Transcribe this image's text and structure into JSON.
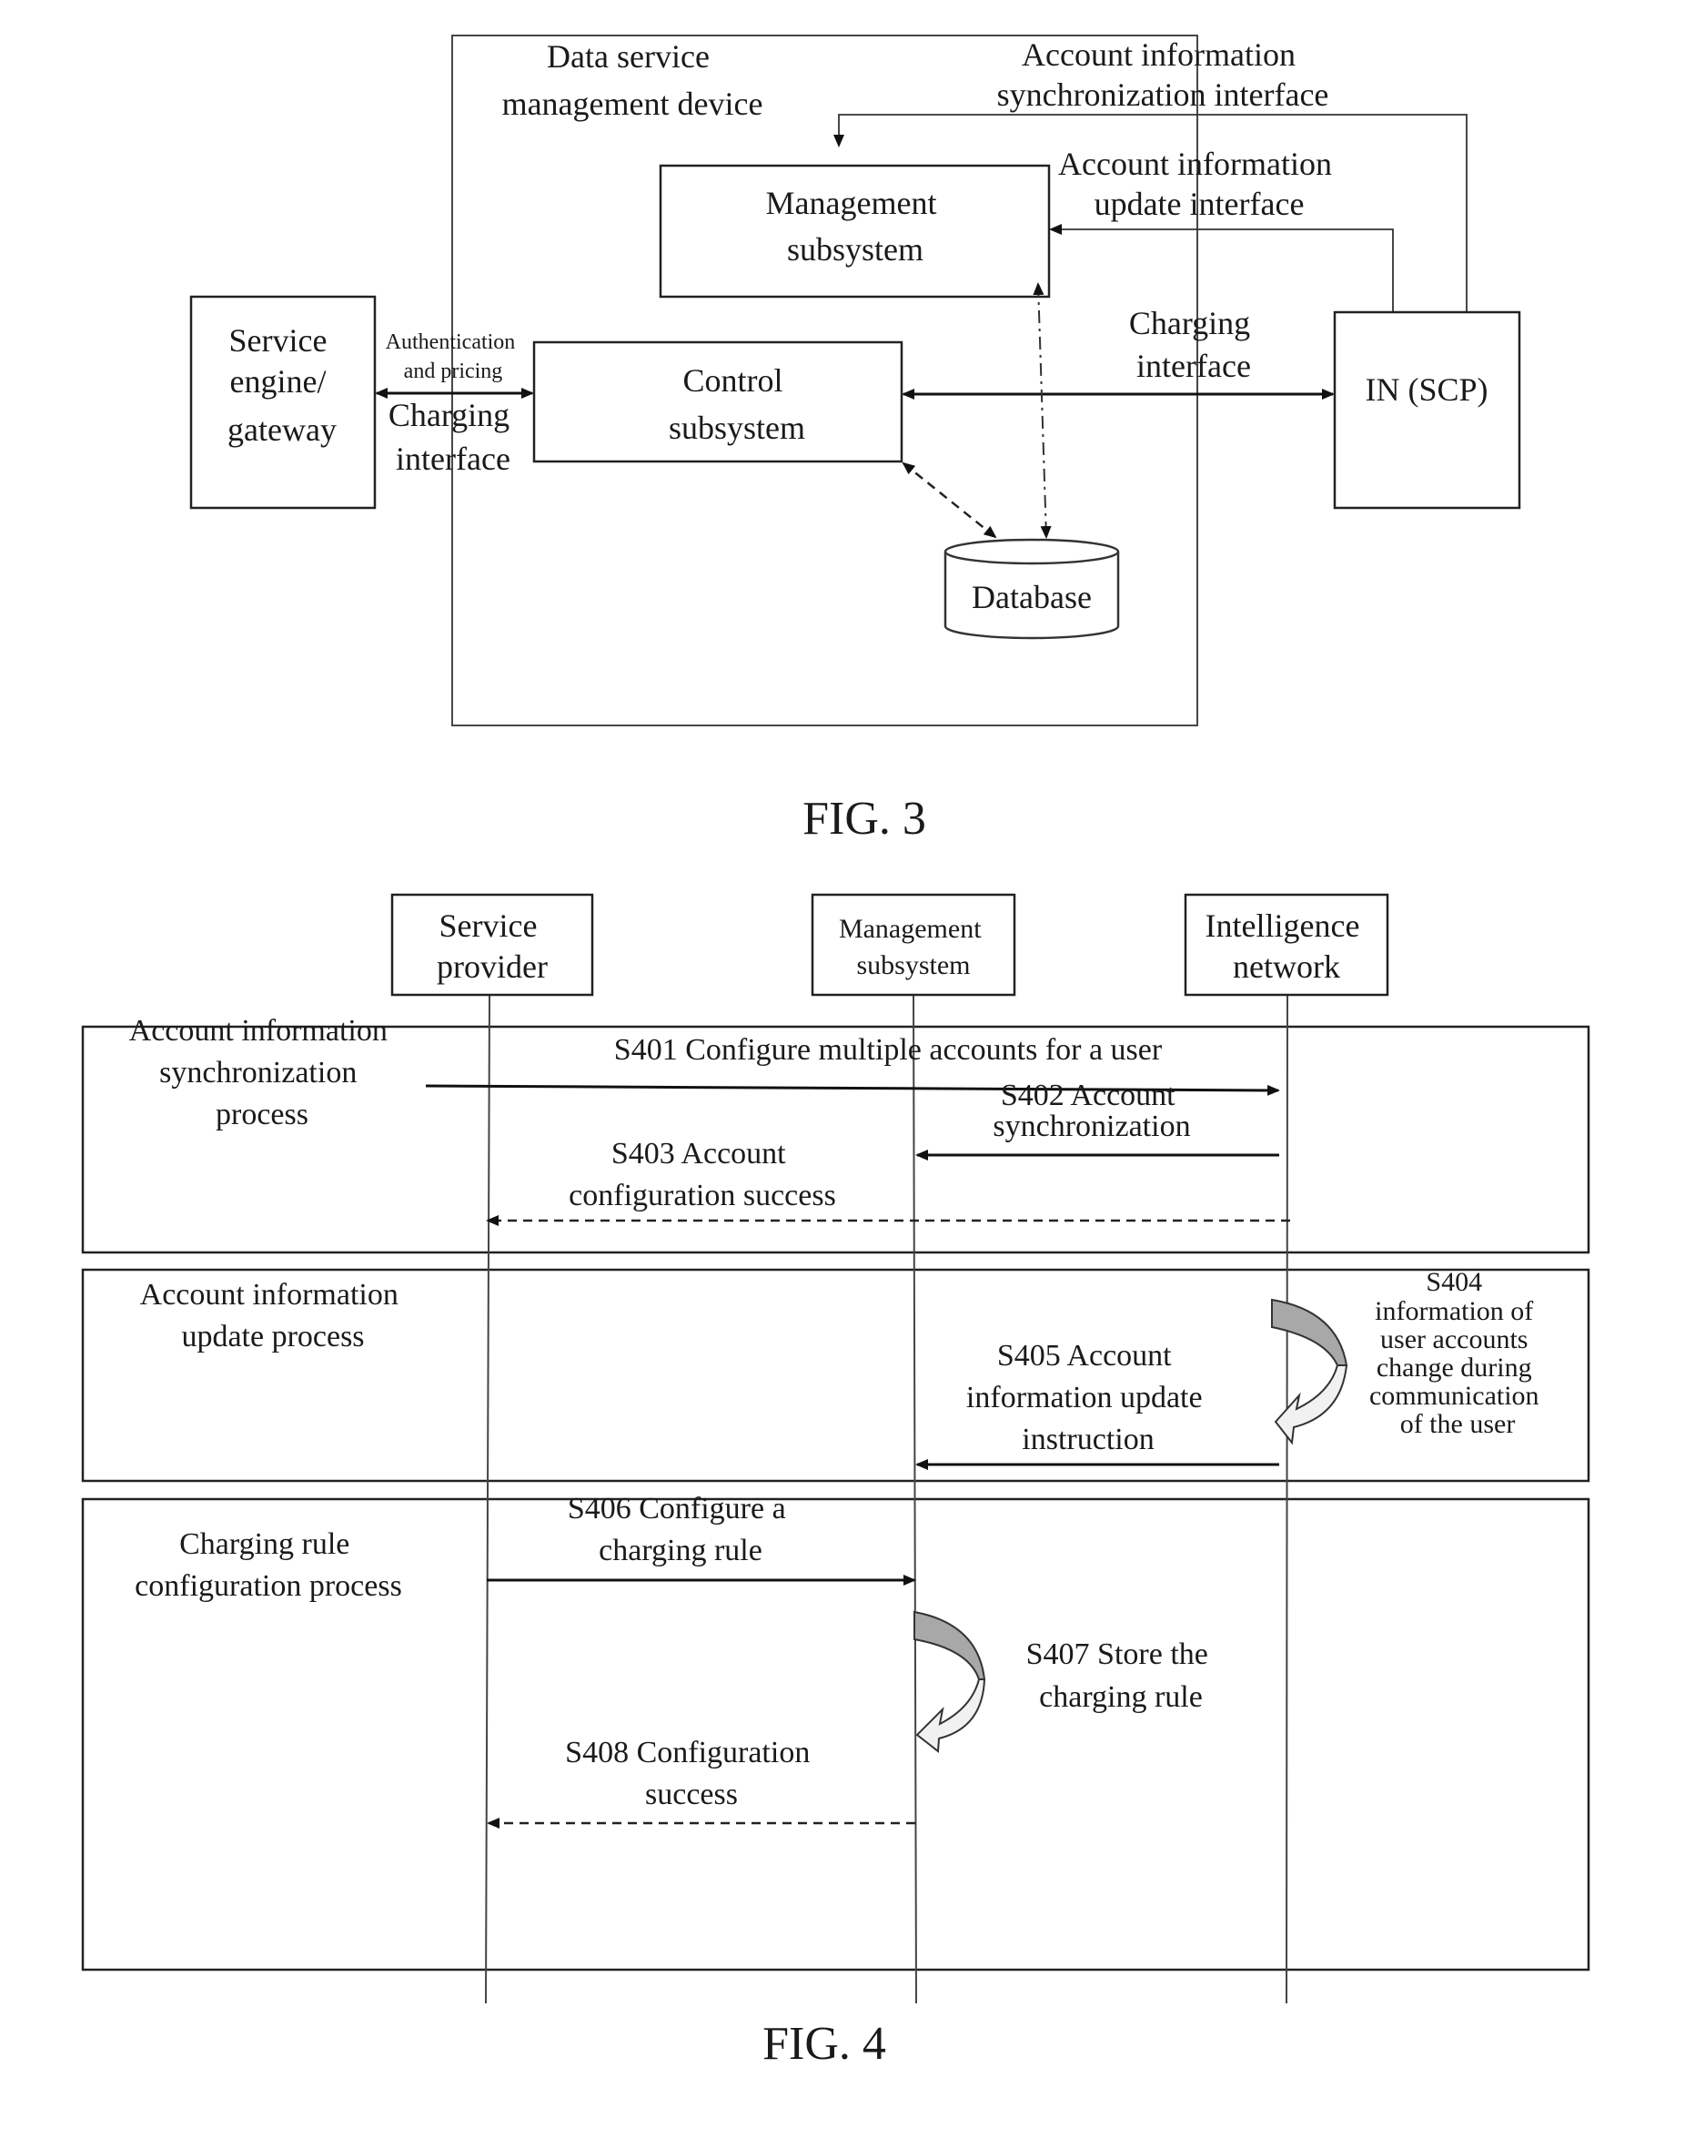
{
  "fig3": {
    "caption": "FIG. 3",
    "container": {
      "title_lines": [
        "Data service",
        "management device"
      ]
    },
    "nodes": {
      "service_engine": [
        "Service",
        "engine/",
        "gateway"
      ],
      "management": [
        "Management",
        "subsystem"
      ],
      "control": [
        "Control",
        "subsystem"
      ],
      "in_scp": [
        "IN (SCP)"
      ],
      "database": [
        "Database"
      ]
    },
    "interfaces": {
      "auth_pricing": [
        "Authentication",
        "and pricing"
      ],
      "charging_left": [
        "Charging",
        "interface"
      ],
      "charging_right": [
        "Charging",
        "interface"
      ],
      "sync": [
        "Account information",
        "synchronization interface"
      ],
      "update": [
        "Account information",
        "update interface"
      ]
    }
  },
  "fig4": {
    "caption": "FIG. 4",
    "lifelines": [
      {
        "id": "sp",
        "lines": [
          "Service",
          "provider"
        ]
      },
      {
        "id": "mgmt",
        "lines": [
          "Management",
          "subsystem"
        ]
      },
      {
        "id": "in",
        "lines": [
          "Intelligence",
          "network"
        ]
      }
    ],
    "sections": [
      {
        "label_lines": [
          "Account information",
          "synchronization",
          "process"
        ]
      },
      {
        "label_lines": [
          "Account information",
          "update process"
        ]
      },
      {
        "label_lines": [
          "Charging rule",
          "configuration process"
        ]
      }
    ],
    "messages": {
      "s401": [
        "S401 Configure multiple accounts for a user"
      ],
      "s402": [
        "S402 Account",
        "synchronization"
      ],
      "s403": [
        "S403 Account",
        "configuration success"
      ],
      "s404": [
        "S404",
        "information of",
        "user accounts",
        "change during",
        "communication",
        "of the user"
      ],
      "s405": [
        "S405 Account",
        "information update",
        "instruction"
      ],
      "s406": [
        "S406 Configure a",
        "charging rule"
      ],
      "s407": [
        "S407 Store the",
        "charging rule"
      ],
      "s408": [
        "S408 Configuration",
        "success"
      ]
    }
  }
}
